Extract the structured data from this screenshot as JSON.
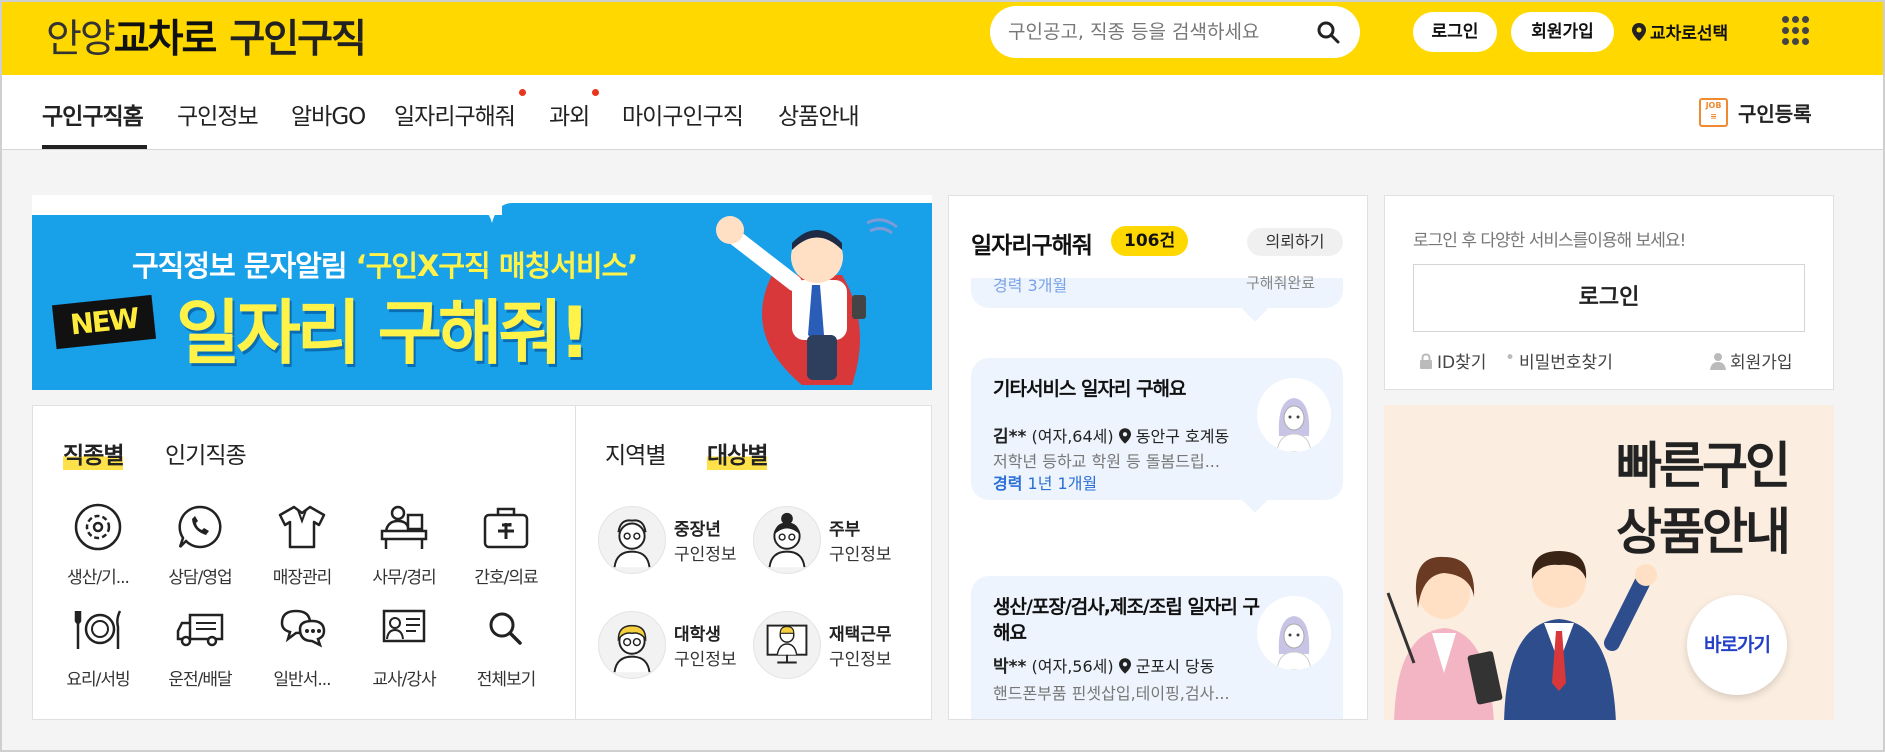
{
  "header": {
    "logo": {
      "part1": "안양",
      "part2": "교차로",
      "part3": "구인구직"
    },
    "search_placeholder": "구인공고, 직종 등을 검색하세요",
    "login_label": "로그인",
    "join_label": "회원가입",
    "region_label": "교차로선택"
  },
  "nav": {
    "items": [
      "구인구직홈",
      "구인정보",
      "알바GO",
      "일자리구해줘",
      "과외",
      "마이구인구직",
      "상품안내"
    ],
    "register_label": "구인등록",
    "job_icon_text": "JOB"
  },
  "banner": {
    "subtitle_pre": "구직정보 문자알림 ",
    "subtitle_highlight": "‘구인X구직 매칭서비스’",
    "badge": "NEW",
    "title": "일자리 구해줘!"
  },
  "categories": {
    "tabs": [
      "직종별",
      "인기직종"
    ],
    "items": [
      "생산/기...",
      "상담/영업",
      "매장관리",
      "사무/경리",
      "간호/의료",
      "요리/서빙",
      "운전/배달",
      "일반서...",
      "교사/강사",
      "전체보기"
    ],
    "target_tabs": [
      "지역별",
      "대상별"
    ],
    "targets": [
      {
        "name": "중장년",
        "sub": "구인정보"
      },
      {
        "name": "주부",
        "sub": "구인정보"
      },
      {
        "name": "대학생",
        "sub": "구인정보"
      },
      {
        "name": "재택근무",
        "sub": "구인정보"
      }
    ]
  },
  "job_request": {
    "title": "일자리구해줘",
    "count": "106건",
    "request_label": "의뢰하기",
    "partial_top": {
      "exp_label": "경력",
      "exp_value": "3개월",
      "status": "구해줘완료"
    },
    "cards": [
      {
        "title": "기타서비스 일자리 구해요",
        "name": "김**",
        "info": "(여자,64세)",
        "location": "동안구 호계동",
        "desc": "저학년 등하교 학원 등 돌봄드립...",
        "exp_label": "경력",
        "exp_value": "1년 1개월"
      },
      {
        "title": "생산/포장/검사,제조/조립 일자리 구해요",
        "name": "박**",
        "info": "(여자,56세)",
        "location": "군포시 당동",
        "desc": "핸드폰부품 핀셋삽입,테이핑,검사..."
      }
    ]
  },
  "login_box": {
    "message": "로그인 후 다양한 서비스를이용해 보세요!",
    "login_button": "로그인",
    "find_id": "ID찾기",
    "find_pw": "비밀번호찾기",
    "join": "회원가입"
  },
  "ad": {
    "line1": "빠른구인",
    "line2": "상품안내",
    "button": "바로가기"
  }
}
